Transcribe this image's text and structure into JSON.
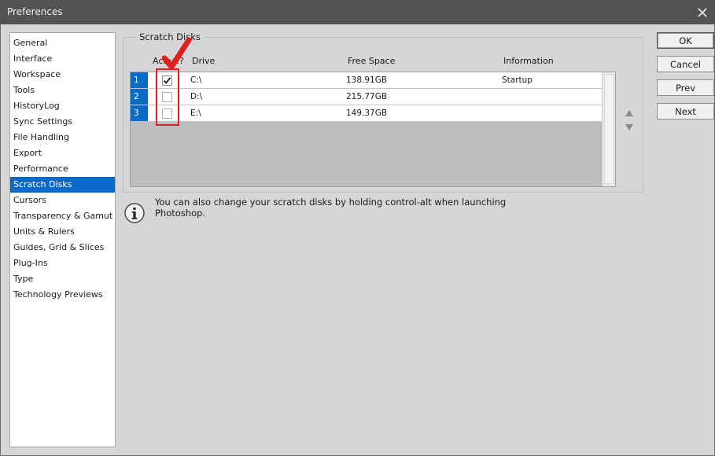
{
  "window": {
    "title": "Preferences"
  },
  "sidebar": {
    "items": [
      {
        "label": "General"
      },
      {
        "label": "Interface"
      },
      {
        "label": "Workspace"
      },
      {
        "label": "Tools"
      },
      {
        "label": "HistoryLog"
      },
      {
        "label": "Sync Settings"
      },
      {
        "label": "File Handling"
      },
      {
        "label": "Export"
      },
      {
        "label": "Performance"
      },
      {
        "label": "Scratch Disks"
      },
      {
        "label": "Cursors"
      },
      {
        "label": "Transparency & Gamut"
      },
      {
        "label": "Units & Rulers"
      },
      {
        "label": "Guides, Grid & Slices"
      },
      {
        "label": "Plug-Ins"
      },
      {
        "label": "Type"
      },
      {
        "label": "Technology Previews"
      }
    ],
    "selected": "Scratch Disks"
  },
  "scratch": {
    "group_title": "Scratch Disks",
    "columns": {
      "active": "Active?",
      "drive": "Drive",
      "free_space": "Free Space",
      "information": "Information"
    },
    "rows": [
      {
        "index": "1",
        "active": true,
        "drive": "C:\\",
        "free_space": "138.91GB",
        "information": "Startup"
      },
      {
        "index": "2",
        "active": false,
        "drive": "D:\\",
        "free_space": "215.77GB",
        "information": ""
      },
      {
        "index": "3",
        "active": false,
        "drive": "E:\\",
        "free_space": "149.37GB",
        "information": ""
      }
    ]
  },
  "info": {
    "text": "You can also change your scratch disks by holding control-alt when launching Photoshop."
  },
  "buttons": {
    "ok": "OK",
    "cancel": "Cancel",
    "prev": "Prev",
    "next": "Next"
  },
  "colors": {
    "selection": "#0a6ac8",
    "titlebar": "#535353",
    "dialog_bg": "#d6d6d6",
    "annotation": "#e02020"
  }
}
